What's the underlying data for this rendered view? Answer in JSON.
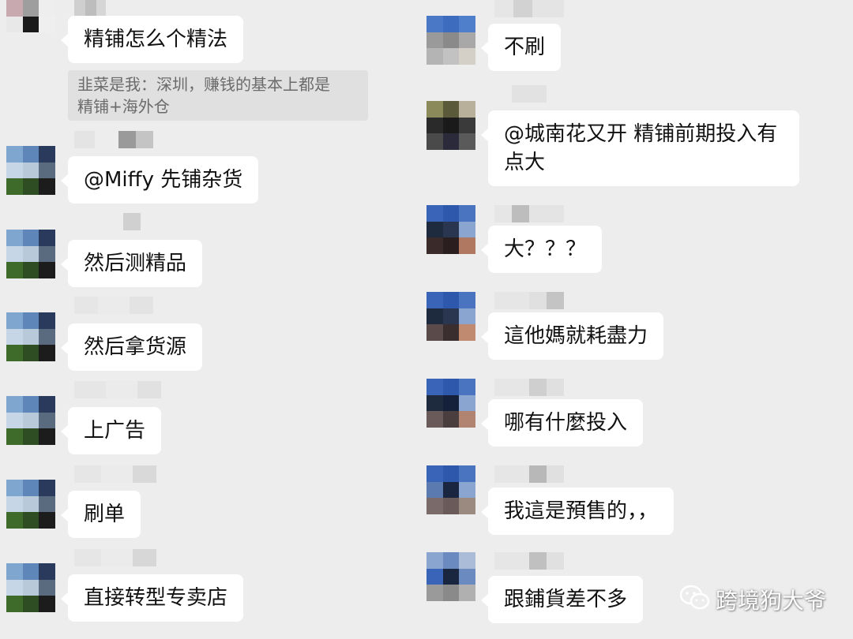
{
  "left_messages": [
    {
      "text": "精铺怎么个精法"
    },
    {
      "text": "@Miffy 先铺杂货"
    },
    {
      "text": "然后测精品"
    },
    {
      "text": "然后拿货源"
    },
    {
      "text": "上广告"
    },
    {
      "text": "刷单"
    },
    {
      "text": "直接转型专卖店"
    }
  ],
  "quote": {
    "line1": "韭菜是我：深圳，赚钱的基本上都是",
    "line2": "精铺+海外仓"
  },
  "right_messages": [
    {
      "text": "不刷"
    },
    {
      "line1": "@城南花又开 精铺前期投入有",
      "line2": "点大"
    },
    {
      "text": "大？？？"
    },
    {
      "text": "這他媽就耗盡力"
    },
    {
      "text": "哪有什麼投入"
    },
    {
      "text": "我這是預售的，，"
    },
    {
      "text": "跟鋪貨差不多"
    }
  ],
  "watermark": {
    "text": "跨境狗大爷",
    "icon": "wechat-icon"
  },
  "colors": {
    "background": "#ededed",
    "bubble": "#ffffff",
    "quote_bg": "#e0e0e0",
    "quote_text": "#6b6b6b"
  }
}
